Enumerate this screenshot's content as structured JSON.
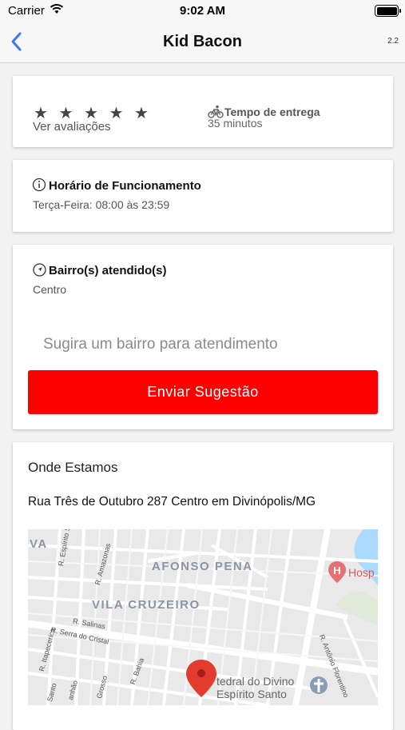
{
  "status_bar": {
    "carrier": "Carrier",
    "time": "9:02 AM"
  },
  "nav": {
    "title": "Kid Bacon",
    "version": "2.2",
    "back_icon": "chevron-left-icon",
    "accent_color": "#3478f6"
  },
  "rating": {
    "stars": "★ ★ ★ ★ ★",
    "rating_value": 0,
    "see_reviews_label": "Ver avaliações",
    "delivery_time_label": "Tempo de entrega",
    "delivery_time_value": "35 minutos"
  },
  "hours": {
    "title": "Horário de Funcionamento",
    "value": "Terça-Feira: 08:00 às 23:59"
  },
  "service_areas": {
    "title": "Bairro(s) atendido(s)",
    "value": "Centro",
    "suggest_placeholder": "Sugira um bairro para atendimento",
    "suggest_value": "",
    "send_button_label": "Enviar Sugestão",
    "button_color": "#fd0000"
  },
  "location": {
    "title": "Onde Estamos",
    "address": "Rua Três de Outubro 287 Centro em Divinópolis/MG",
    "map": {
      "neighborhoods": [
        "VA",
        "AFONSO PENA",
        "VILA CRUZEIRO"
      ],
      "streets": [
        "R. Espírito Santo",
        "R. Amazonas",
        "R. Salinas",
        "R. Serra do Cristal",
        "R. Itapecerica",
        "R. Bahia",
        "Grosso",
        "anhão",
        "Santo",
        "R. Antônio Florentino"
      ],
      "poi_hospital": "Hosp",
      "poi_church_line1": "tedral do Divino",
      "poi_church_line2": "Espírito Santo"
    }
  }
}
